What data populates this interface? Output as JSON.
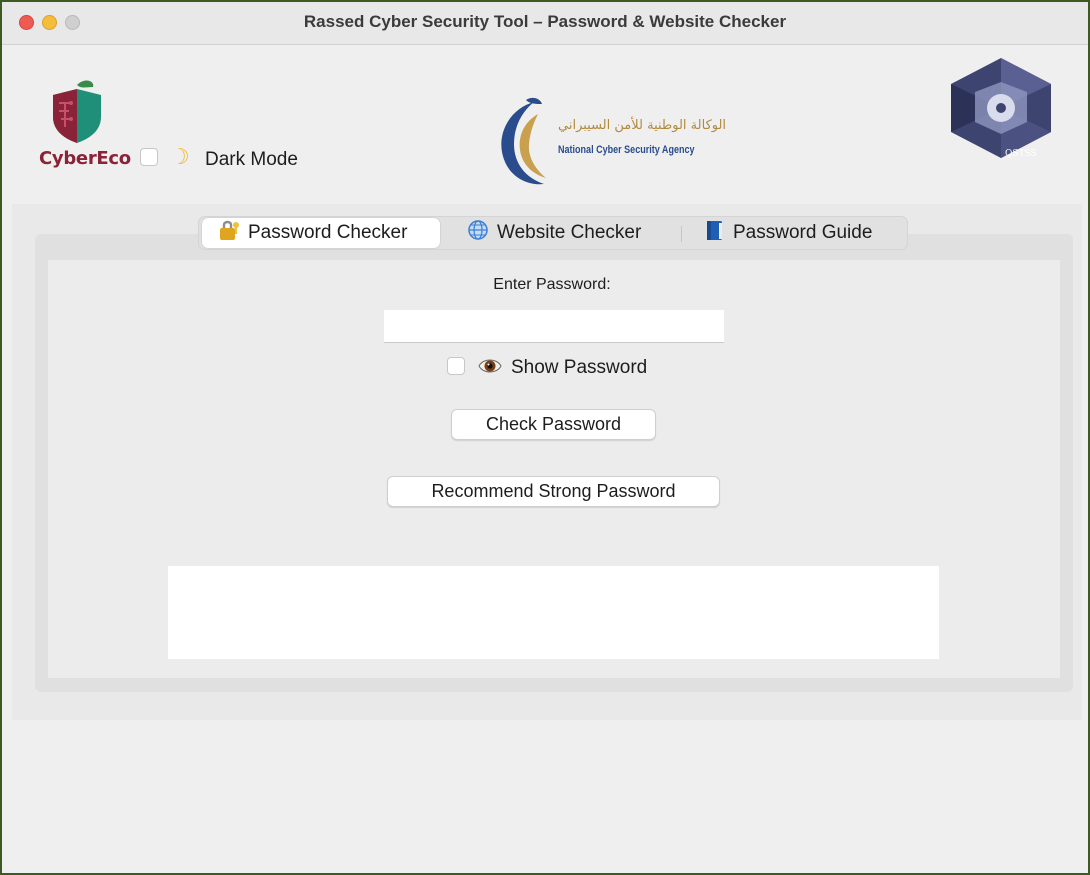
{
  "window": {
    "title": "Rassed Cyber Security Tool – Password & Website Checker"
  },
  "header": {
    "cybereco_logo_text": "CyberEco",
    "dark_mode": {
      "icon": "moon-icon",
      "label": "Dark Mode",
      "checked": false
    },
    "ncsa_logo": {
      "arabic": "الوكالة الوطنية للأمن السيبراني",
      "english": "National Cyber Security Agency"
    },
    "qstss_logo_text": "QSTSS"
  },
  "tabs": [
    {
      "icon": "lock-icon",
      "label": "Password Checker",
      "active": true
    },
    {
      "icon": "globe-icon",
      "label": "Website Checker",
      "active": false
    },
    {
      "icon": "book-icon",
      "label": "Password Guide",
      "active": false
    }
  ],
  "password_checker": {
    "enter_label": "Enter Password:",
    "password_value": "",
    "show_password": {
      "icon": "eye-icon",
      "label": "Show Password",
      "checked": false
    },
    "check_button": "Check Password",
    "recommend_button": "Recommend Strong Password",
    "result_text": ""
  },
  "colors": {
    "cybereco_brand": "#8a2238",
    "window_border": "#3d5a23",
    "moon": "#f2b92f"
  }
}
